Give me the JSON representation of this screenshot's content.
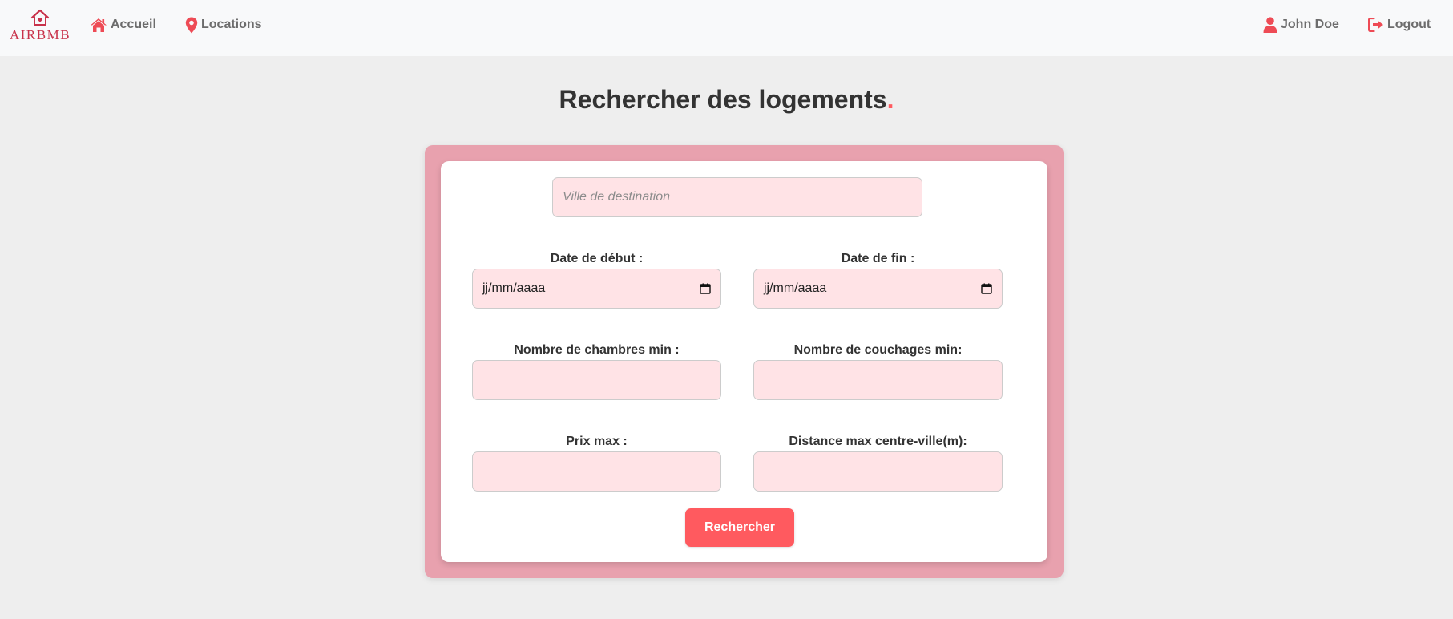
{
  "navbar": {
    "logo_text": "AIRBMB",
    "links": {
      "home": "Accueil",
      "locations": "Locations",
      "user": "John Doe",
      "logout": "Logout"
    }
  },
  "page": {
    "title": "Rechercher des logements",
    "title_dot": "."
  },
  "form": {
    "destination": {
      "placeholder": "Ville de destination",
      "value": ""
    },
    "start_date": {
      "label": "Date de début :",
      "display": "jj/mm/aaaa"
    },
    "end_date": {
      "label": "Date de fin :",
      "display": "jj/mm/aaaa"
    },
    "min_rooms": {
      "label": "Nombre de chambres min :",
      "value": ""
    },
    "min_beds": {
      "label": "Nombre de couchages min:",
      "value": ""
    },
    "max_price": {
      "label": "Prix max :",
      "value": ""
    },
    "max_distance": {
      "label": "Distance max centre-ville(m):",
      "value": ""
    },
    "submit_label": "Rechercher"
  },
  "colors": {
    "accent": "#ff5a5f",
    "card_outer": "#e8a1ae",
    "input_bg": "#ffe3e6",
    "logo": "#c8324a"
  },
  "icons": {
    "logo": "house-heart-icon",
    "home": "home-icon",
    "locations": "map-marker-icon",
    "user": "user-icon",
    "logout": "sign-out-icon",
    "calendar": "calendar-icon"
  }
}
